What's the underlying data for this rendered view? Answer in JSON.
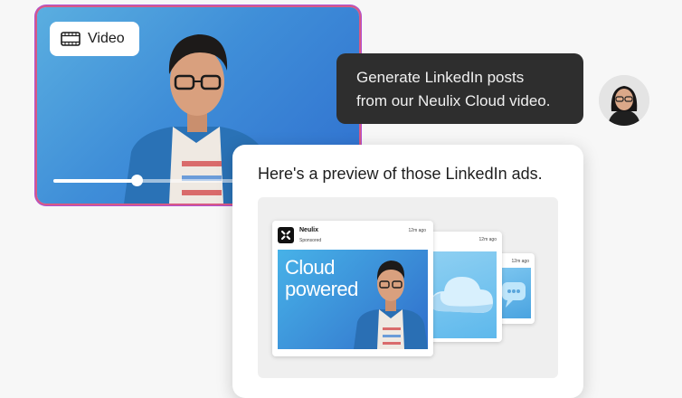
{
  "video_card": {
    "chip_label": "Video",
    "chip_icon": "film-icon",
    "progress_fraction": 0.46,
    "gradient_colors": [
      "#5aaee0",
      "#2f6fcf"
    ],
    "border_colors": [
      "#d75a86",
      "#b04fd0"
    ]
  },
  "prompt": {
    "line1": "Generate LinkedIn posts",
    "line2": "from our Neulix Cloud video."
  },
  "response": {
    "title": "Here's a preview of those LinkedIn ads.",
    "ads": [
      {
        "brand": "Neulix",
        "sponsored": "Sponsored",
        "time": "12m ago",
        "headline_line1": "Cloud",
        "headline_line2": "powered"
      },
      {
        "time": "12m ago"
      },
      {
        "time": "12m ago"
      }
    ]
  }
}
